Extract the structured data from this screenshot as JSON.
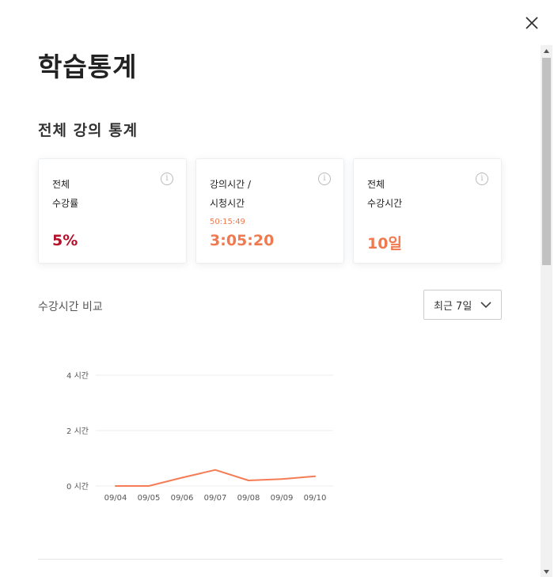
{
  "title": "학습통계",
  "section_title": "전체 강의 통계",
  "cards": [
    {
      "label_line1": "전체",
      "label_line2": "수강률",
      "value": "5%",
      "sub": "",
      "value_color": "#b4102a"
    },
    {
      "label_line1": "강의시간 /",
      "label_line2": "시청시간",
      "value": "3:05:20",
      "sub": "50:15:49",
      "value_color": "#f07a4f"
    },
    {
      "label_line1": "전체",
      "label_line2": "수강시간",
      "value": "10일",
      "sub": "",
      "value_color": "#f07a4f"
    }
  ],
  "info_glyph": "i",
  "compare": {
    "label": "수강시간 비교",
    "period": "최근 7일"
  },
  "chart_data": {
    "type": "line",
    "x": [
      "09/04",
      "09/05",
      "09/06",
      "09/07",
      "09/08",
      "09/09",
      "09/10"
    ],
    "ylim": [
      0,
      4
    ],
    "yticks": [
      0,
      2,
      4
    ],
    "ytick_labels": [
      "0 시간",
      "2 시간",
      "4 시간"
    ],
    "series": [
      {
        "values": [
          0,
          0,
          0.3,
          0.58,
          0.2,
          0.25,
          0.35
        ]
      }
    ],
    "line_color": "#f57c54",
    "grid": true
  }
}
